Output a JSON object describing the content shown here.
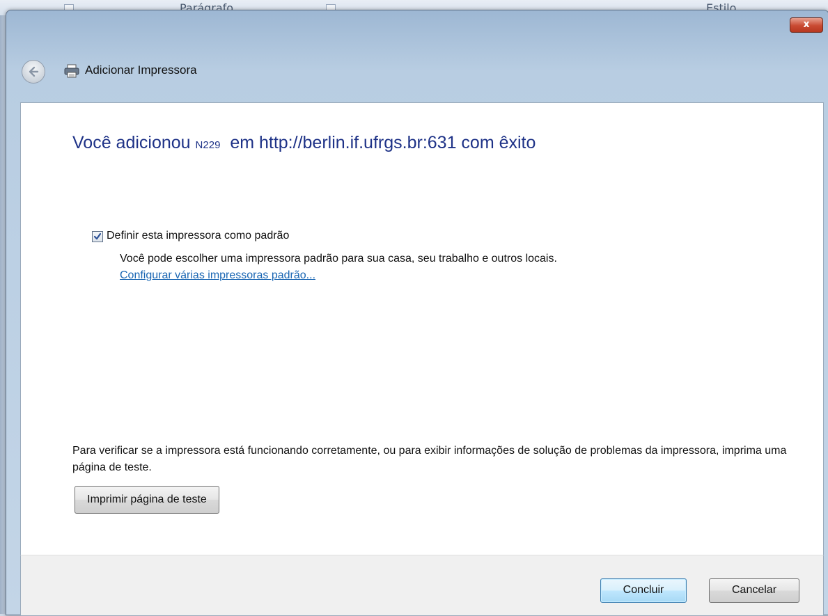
{
  "background_app": {
    "ribbon_group_1": "Parágrafo",
    "ribbon_group_2": "Estilo"
  },
  "window": {
    "close_label": "x"
  },
  "nav": {
    "title": "Adicionar Impressora",
    "back_icon": "back-arrow-icon",
    "printer_icon": "printer-icon"
  },
  "main": {
    "heading_prefix": "Você adicionou",
    "printer_name": "N229",
    "heading_suffix": "em http://berlin.if.ufrgs.br:631 com êxito",
    "default_checkbox_label": "Definir esta impressora como padrão",
    "default_checkbox_checked": true,
    "default_description": "Você pode escolher uma impressora padrão para sua casa, seu trabalho e outros locais.",
    "default_link": "Configurar várias impressoras padrão...",
    "test_paragraph": "Para verificar se a impressora está funcionando corretamente, ou para exibir informações de solução de problemas da impressora, imprima uma página de teste.",
    "test_button": "Imprimir página de teste"
  },
  "footer": {
    "finish_button": "Concluir",
    "cancel_button": "Cancelar"
  },
  "colors": {
    "heading": "#1e3287",
    "link": "#1a66b3",
    "close_button": "#c94a32"
  }
}
